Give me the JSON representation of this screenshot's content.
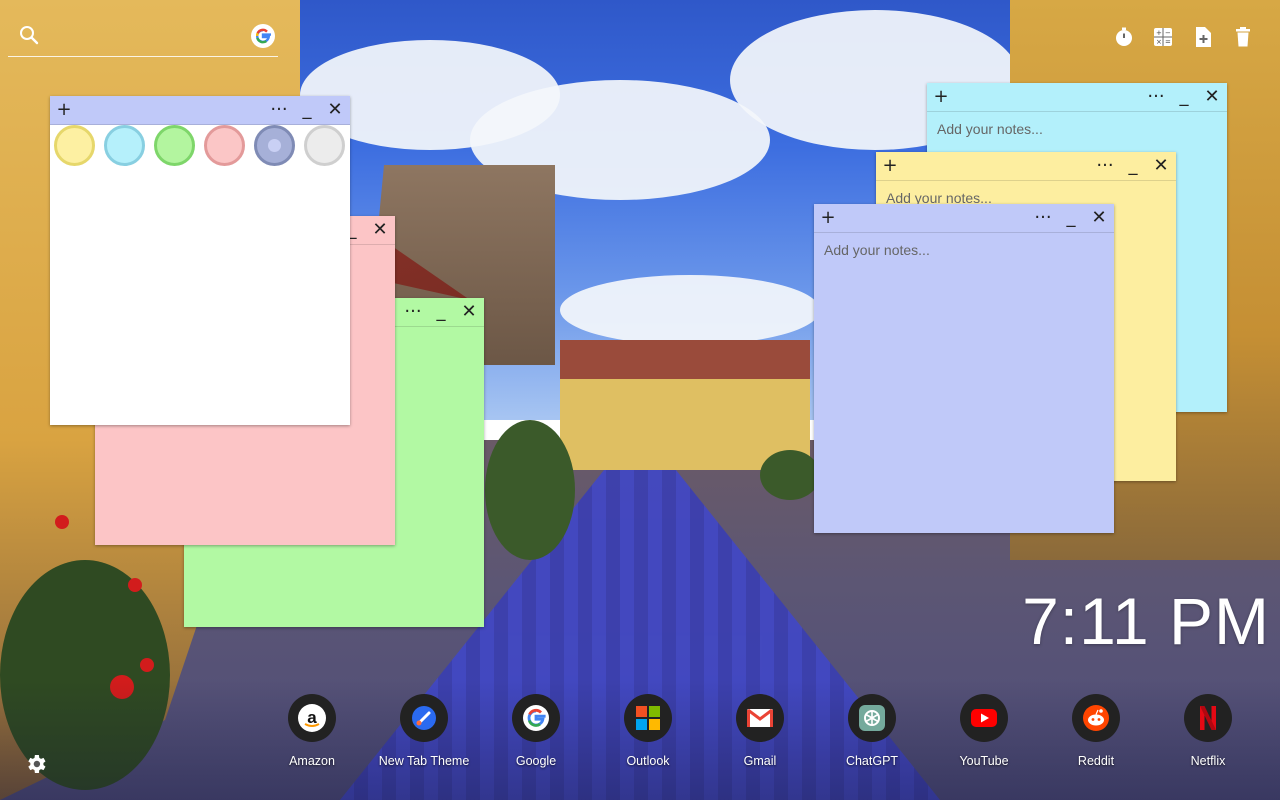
{
  "topbar": {
    "search_icon": "search-icon",
    "google_icon": "google-g-icon"
  },
  "toolbar": {
    "items": [
      {
        "icon": "timer-icon"
      },
      {
        "icon": "calculator-icon"
      },
      {
        "icon": "add-note-icon"
      },
      {
        "icon": "trash-icon"
      }
    ]
  },
  "notes": {
    "header_add": "+",
    "header_menu": "···",
    "header_minimize": "_",
    "header_close": "✕",
    "placeholder": "Add your notes...",
    "colors": {
      "yellow": "#fdeea0",
      "blue": "#b3f0fb",
      "green": "#b2f9a3",
      "pink": "#fcc5c6",
      "periwinkle": "#c0c9f9",
      "white": "#ffffff"
    }
  },
  "color_picker": {
    "swatches": [
      {
        "name": "yellow",
        "fill": "#fdf0a2",
        "border": "#e6d76b"
      },
      {
        "name": "blue",
        "fill": "#b5f0fb",
        "border": "#88cfe1"
      },
      {
        "name": "green",
        "fill": "#b3f59f",
        "border": "#7ed66a"
      },
      {
        "name": "pink",
        "fill": "#fbc6c6",
        "border": "#e39a9a"
      },
      {
        "name": "periwinkle",
        "fill": "#a6b0d8",
        "border": "#7f8bb5",
        "selected": true
      },
      {
        "name": "gray",
        "fill": "#ececec",
        "border": "#cfcfcf"
      }
    ]
  },
  "clock": {
    "time": "7:11 PM"
  },
  "dock": {
    "items": [
      {
        "label": "Amazon",
        "icon": "amazon-icon"
      },
      {
        "label": "New Tab Theme",
        "icon": "new-tab-theme-icon"
      },
      {
        "label": "Google",
        "icon": "google-icon"
      },
      {
        "label": "Outlook",
        "icon": "outlook-icon"
      },
      {
        "label": "Gmail",
        "icon": "gmail-icon"
      },
      {
        "label": "ChatGPT",
        "icon": "chatgpt-icon"
      },
      {
        "label": "YouTube",
        "icon": "youtube-icon"
      },
      {
        "label": "Reddit",
        "icon": "reddit-icon"
      },
      {
        "label": "Netflix",
        "icon": "netflix-icon"
      }
    ]
  },
  "settings": {
    "icon": "gear-icon"
  }
}
